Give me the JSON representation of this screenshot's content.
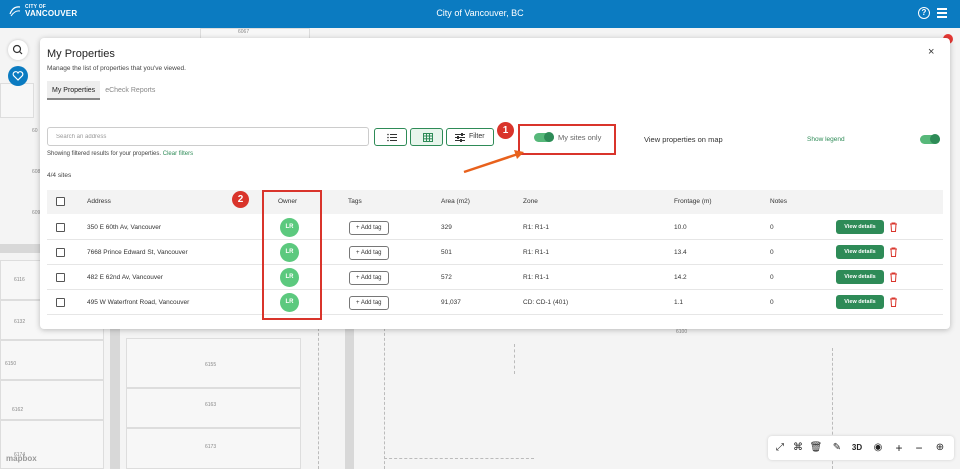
{
  "header": {
    "logo_line1": "CITY OF",
    "logo_line2": "VANCOUVER",
    "title": "City of Vancouver, BC",
    "help_icon": "question-circle-icon",
    "menu_icon": "hamburger-icon"
  },
  "map": {
    "lot_numbers": [
      "6067",
      "60",
      "608",
      "609",
      "6116",
      "6132",
      "6150",
      "6162",
      "6174",
      "6155",
      "6163",
      "6173",
      "6100"
    ],
    "attribution": "mapbox"
  },
  "panel": {
    "title": "My Properties",
    "subtitle": "Manage the list of properties that you've viewed.",
    "close_label": "×",
    "tabs": [
      {
        "label": "My Properties",
        "active": true
      },
      {
        "label": "eCheck Reports",
        "active": false
      }
    ],
    "search_placeholder": "Search an address",
    "filter_text": "Showing filtered results for your properties.",
    "clear_filters": "Clear filters",
    "filter_button": "Filter",
    "my_sites_label": "My sites only",
    "map_view_label": "View properties on map",
    "show_legend": "Show legend",
    "count_text": "4/4 sites"
  },
  "table": {
    "headers": [
      "Address",
      "Owner",
      "Tags",
      "Area (m2)",
      "Zone",
      "Frontage (m)",
      "Notes"
    ],
    "rows": [
      {
        "address": "350 E 60th Av, Vancouver",
        "owner": "LR",
        "tag": "+ Add tag",
        "area": "329",
        "zone": "R1: R1-1",
        "frontage": "10.0",
        "notes": "0",
        "action": "View details"
      },
      {
        "address": "7668 Prince Edward St, Vancouver",
        "owner": "LR",
        "tag": "+ Add tag",
        "area": "501",
        "zone": "R1: R1-1",
        "frontage": "13.4",
        "notes": "0",
        "action": "View details"
      },
      {
        "address": "482 E 62nd Av, Vancouver",
        "owner": "LR",
        "tag": "+ Add tag",
        "area": "572",
        "zone": "R1: R1-1",
        "frontage": "14.2",
        "notes": "0",
        "action": "View details"
      },
      {
        "address": "495 W Waterfront Road, Vancouver",
        "owner": "LR",
        "tag": "+ Add tag",
        "area": "91,037",
        "zone": "CD: CD-1 (401)",
        "frontage": "1.1",
        "notes": "0",
        "action": "View details"
      }
    ]
  },
  "annotations": {
    "one": "1",
    "two": "2"
  },
  "colors": {
    "brand_blue": "#0b7bc1",
    "accent_green": "#2e8b57",
    "annotation_red": "#d9342b"
  },
  "toolbar": {
    "label_3d": "3D",
    "plus": "+",
    "minus": "−"
  }
}
